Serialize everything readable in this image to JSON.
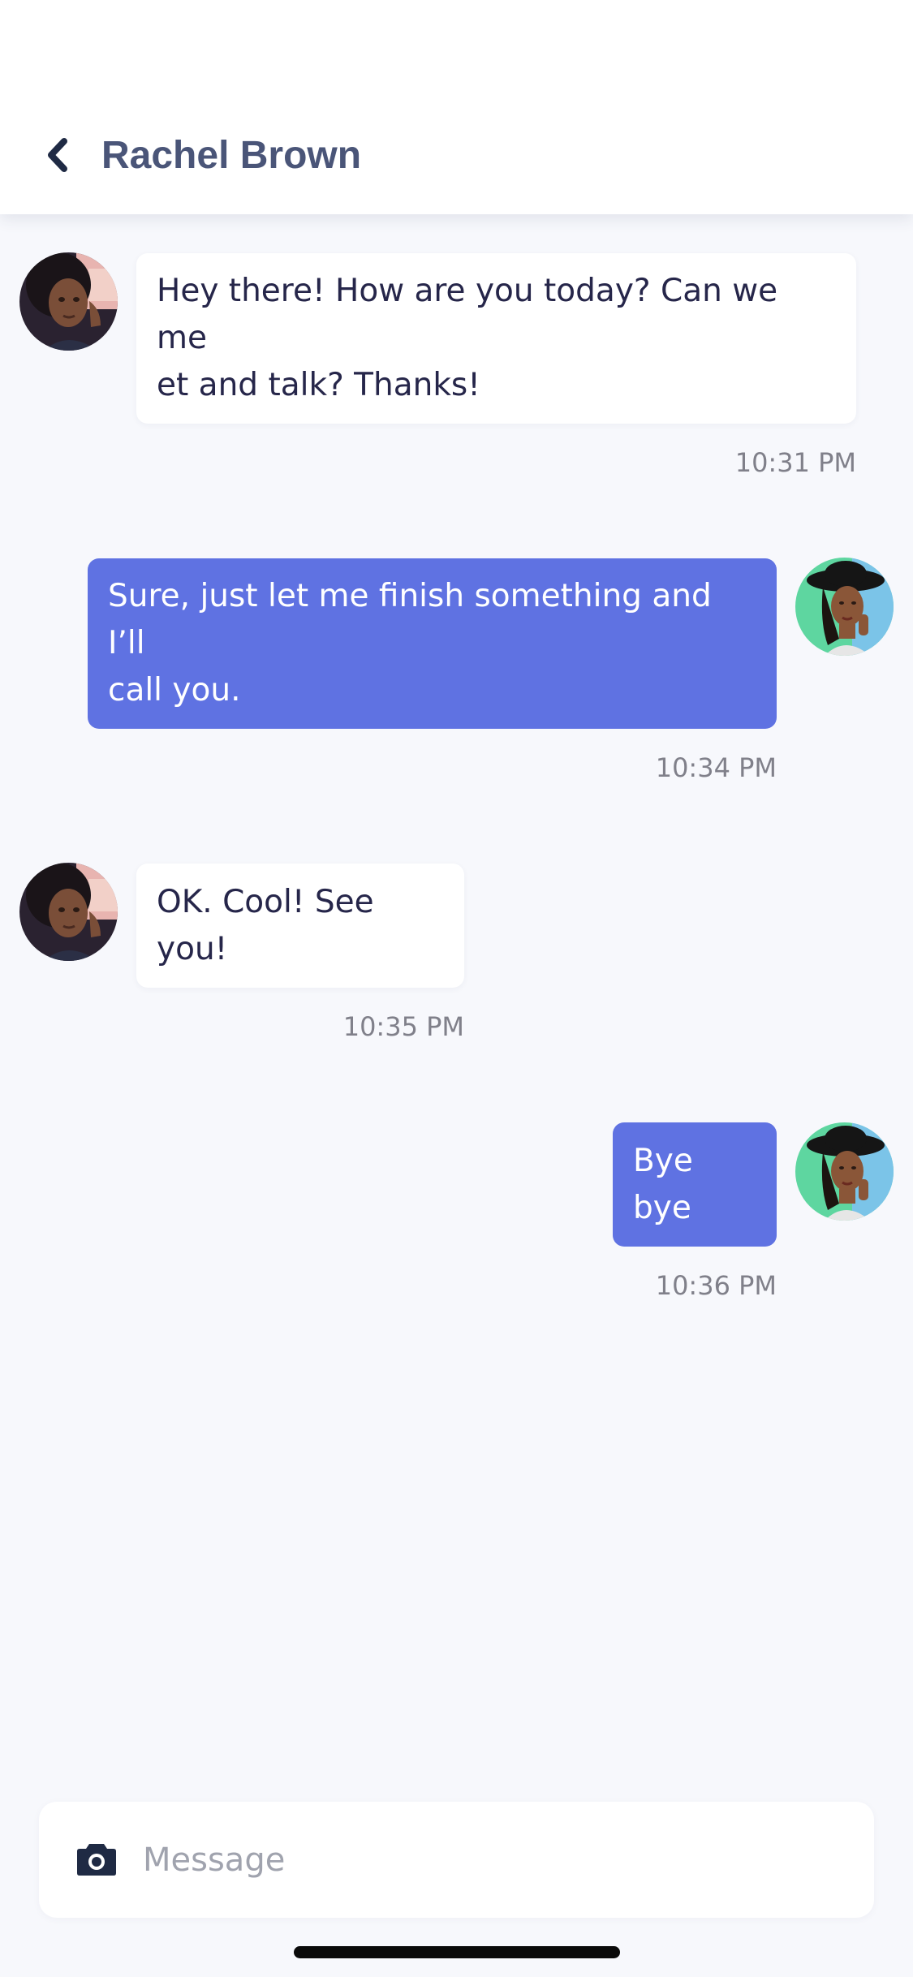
{
  "header": {
    "back_icon": "chevron-left-icon",
    "title": "Rachel Brown"
  },
  "messages": [
    {
      "direction": "incoming",
      "text": "Hey there! How are you today? Can we me­et and talk? Thanks!",
      "line1": "Hey there! How are you today? Can we me",
      "line2": "et and talk? Thanks!",
      "time": "10:31 PM"
    },
    {
      "direction": "outgoing",
      "line1": "Sure, just let me finish something and I’ll",
      "line2": "call you.",
      "time": "10:34 PM"
    },
    {
      "direction": "incoming",
      "line1": "OK. Cool! See you!",
      "time": "10:35 PM"
    },
    {
      "direction": "outgoing",
      "line1": "Bye bye",
      "time": "10:36 PM"
    }
  ],
  "composer": {
    "camera_icon": "camera-icon",
    "placeholder": "Message",
    "value": ""
  },
  "colors": {
    "background": "#F7F8FC",
    "outgoing_bubble": "#5F72E2",
    "incoming_bubble": "#FFFFFF",
    "header_title": "#4A5578"
  }
}
